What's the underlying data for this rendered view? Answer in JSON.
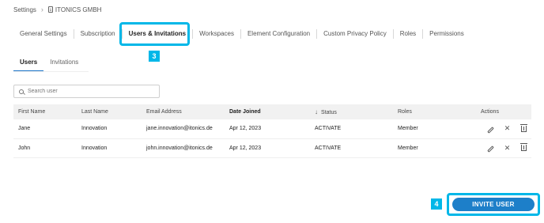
{
  "breadcrumb": {
    "root": "Settings",
    "separator": "›",
    "org": "ITONICS GMBH"
  },
  "tabs": [
    {
      "label": "General Settings"
    },
    {
      "label": "Subscription"
    },
    {
      "label": "Users & Invitations",
      "active": true
    },
    {
      "label": "Workspaces"
    },
    {
      "label": "Element Configuration"
    },
    {
      "label": "Custom Privacy Policy"
    },
    {
      "label": "Roles"
    },
    {
      "label": "Permissions"
    }
  ],
  "callouts": {
    "tab_step": "3",
    "button_step": "4",
    "highlight_color": "#00b7e8"
  },
  "subtabs": [
    {
      "label": "Users",
      "active": true
    },
    {
      "label": "Invitations"
    }
  ],
  "search": {
    "placeholder": "Search user",
    "value": ""
  },
  "table": {
    "columns": [
      "First Name",
      "Last Name",
      "Email Address",
      "Date Joined",
      "Status",
      "Roles",
      "Actions"
    ],
    "sorted_column": "Date Joined",
    "rows": [
      {
        "first": "Jane",
        "last": "Innovation",
        "email": "jane.innovation@itonics.de",
        "date": "Apr 12, 2023",
        "status": "ACTIVATE",
        "role": "Member"
      },
      {
        "first": "John",
        "last": "Innovation",
        "email": "john.innovation@itonics.de",
        "date": "Apr 12, 2023",
        "status": "ACTIVATE",
        "role": "Member"
      }
    ],
    "row_actions": [
      "edit-icon",
      "remove-icon",
      "delete-icon"
    ]
  },
  "invite_button": {
    "label": "INVITE USER",
    "color": "#1d7fc9"
  }
}
